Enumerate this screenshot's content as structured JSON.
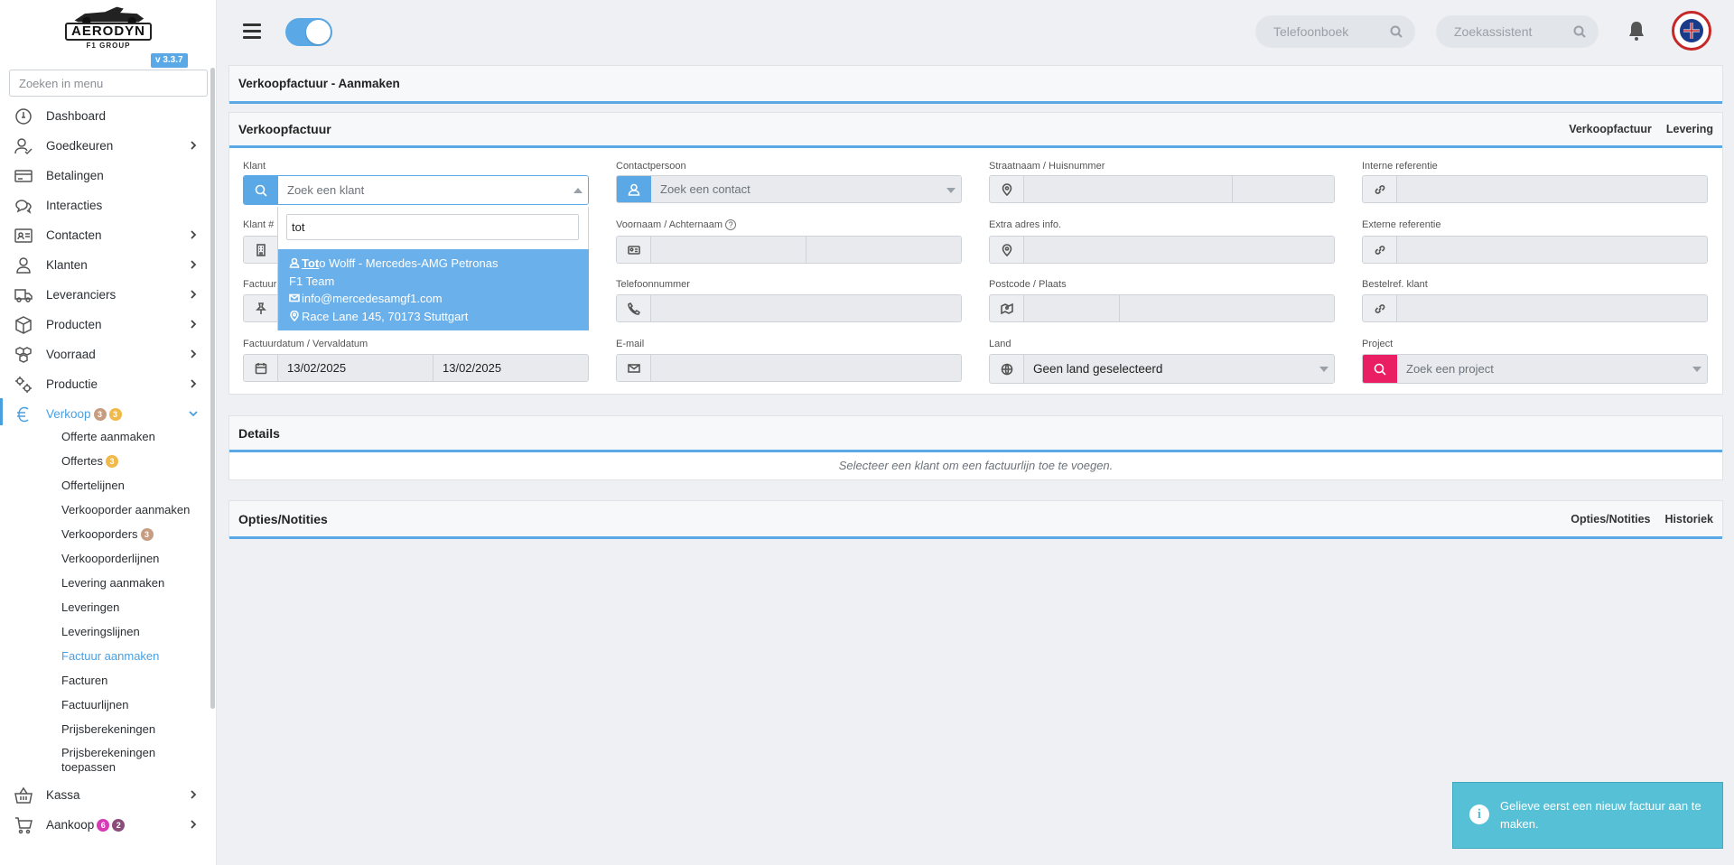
{
  "brand": {
    "name": "AERODYN",
    "tagline": "F1 GROUP",
    "version": "v 3.3.7"
  },
  "sidebar": {
    "search_placeholder": "Zoeken in menu",
    "items": [
      {
        "label": "Dashboard",
        "icon": "dashboard-icon",
        "chevron": false
      },
      {
        "label": "Goedkeuren",
        "icon": "user-check-icon",
        "chevron": true
      },
      {
        "label": "Betalingen",
        "icon": "credit-card-icon",
        "chevron": false
      },
      {
        "label": "Interacties",
        "icon": "chat-icon",
        "chevron": false
      },
      {
        "label": "Contacten",
        "icon": "contact-card-icon",
        "chevron": true
      },
      {
        "label": "Klanten",
        "icon": "user-icon",
        "chevron": true
      },
      {
        "label": "Leveranciers",
        "icon": "truck-icon",
        "chevron": true
      },
      {
        "label": "Producten",
        "icon": "box-icon",
        "chevron": true
      },
      {
        "label": "Voorraad",
        "icon": "boxes-icon",
        "chevron": true
      },
      {
        "label": "Productie",
        "icon": "gears-icon",
        "chevron": true
      }
    ],
    "verkoop": {
      "label": "Verkoop",
      "badge1": "3",
      "badge2": "3"
    },
    "verkoop_sub": [
      {
        "label": "Offerte aanmaken"
      },
      {
        "label": "Offertes",
        "badge": "3"
      },
      {
        "label": "Offertelijnen"
      },
      {
        "label": "Verkooporder aanmaken"
      },
      {
        "label": "Verkooporders",
        "badge": "3"
      },
      {
        "label": "Verkooporderlijnen"
      },
      {
        "label": "Levering aanmaken"
      },
      {
        "label": "Leveringen"
      },
      {
        "label": "Leveringslijnen"
      },
      {
        "label": "Factuur aanmaken"
      },
      {
        "label": "Facturen"
      },
      {
        "label": "Factuurlijnen"
      },
      {
        "label": "Prijsberekeningen"
      },
      {
        "label": "Prijsberekeningen toepassen"
      }
    ],
    "kassa": {
      "label": "Kassa"
    },
    "aankoop": {
      "label": "Aankoop",
      "badge1": "6",
      "badge2": "2"
    }
  },
  "topbar": {
    "phonebook_placeholder": "Telefoonboek",
    "assistant_placeholder": "Zoekassistent"
  },
  "page": {
    "title": "Verkoopfactuur - Aanmaken"
  },
  "form": {
    "title": "Verkoopfactuur",
    "tabs": [
      "Verkoopfactuur",
      "Levering"
    ],
    "labels": {
      "klant": "Klant",
      "klant_nr": "Klant #",
      "factuur": "Factuur",
      "factuurdatum": "Factuurdatum / Vervaldatum",
      "contactpersoon": "Contactpersoon",
      "voornaam": "Voornaam / Achternaam",
      "telefoon": "Telefoonnummer",
      "email": "E-mail",
      "straat": "Straatnaam / Huisnummer",
      "extra_adres": "Extra adres info.",
      "postcode": "Postcode / Plaats",
      "land": "Land",
      "interne_ref": "Interne referentie",
      "externe_ref": "Externe referentie",
      "bestelref": "Bestelref. klant",
      "project": "Project"
    },
    "klant_placeholder": "Zoek een klant",
    "contact_placeholder": "Zoek een contact",
    "project_placeholder": "Zoek een project",
    "land_value": "Geen land geselecteerd",
    "factuurdatum": "13/02/2025",
    "vervaldatum": "13/02/2025"
  },
  "dropdown": {
    "query": "tot",
    "match": "Tot",
    "name_rest": "o Wolff - Mercedes-AMG Petronas",
    "name_line2": "F1 Team",
    "email": "info@mercedesamgf1.com",
    "address": "Race Lane 145, 70173 Stuttgart"
  },
  "details": {
    "title": "Details",
    "empty": "Selecteer een klant om een factuurlijn toe te voegen."
  },
  "opties": {
    "title": "Opties/Notities",
    "tabs": [
      "Opties/Notities",
      "Historiek"
    ]
  },
  "toast": {
    "message": "Gelieve eerst een nieuw factuur aan te maken."
  },
  "colors": {
    "accent": "#5aa9e6",
    "project_addon": "#e91e63",
    "toast": "#55c0d6"
  }
}
